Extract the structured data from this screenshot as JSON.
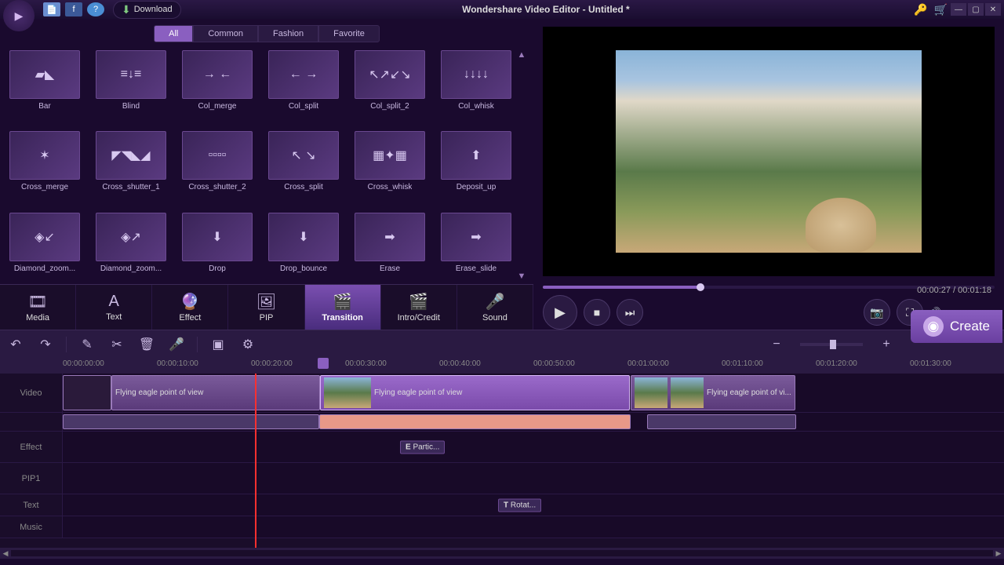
{
  "titlebar": {
    "download": "Download",
    "title": "Wondershare Video Editor - Untitled *"
  },
  "filters": [
    "All",
    "Common",
    "Fashion",
    "Favorite"
  ],
  "transitions": [
    {
      "name": "Bar",
      "glyph": "▰◣"
    },
    {
      "name": "Blind",
      "glyph": "≡↓≡"
    },
    {
      "name": "Col_merge",
      "glyph": "→ ←"
    },
    {
      "name": "Col_split",
      "glyph": "← →"
    },
    {
      "name": "Col_split_2",
      "glyph": "↖↗↙↘"
    },
    {
      "name": "Col_whisk",
      "glyph": "↓↓↓↓"
    },
    {
      "name": "Cross_merge",
      "glyph": "✶"
    },
    {
      "name": "Cross_shutter_1",
      "glyph": "◤◥◣◢"
    },
    {
      "name": "Cross_shutter_2",
      "glyph": "▫▫▫▫"
    },
    {
      "name": "Cross_split",
      "glyph": "↖ ↘"
    },
    {
      "name": "Cross_whisk",
      "glyph": "▦✦▦"
    },
    {
      "name": "Deposit_up",
      "glyph": "⬆"
    },
    {
      "name": "Diamond_zoom...",
      "glyph": "◈↙"
    },
    {
      "name": "Diamond_zoom...",
      "glyph": "◈↗"
    },
    {
      "name": "Drop",
      "glyph": "⬇"
    },
    {
      "name": "Drop_bounce",
      "glyph": "⬇"
    },
    {
      "name": "Erase",
      "glyph": "➡"
    },
    {
      "name": "Erase_slide",
      "glyph": "➡"
    }
  ],
  "categories": [
    "Media",
    "Text",
    "Effect",
    "PIP",
    "Transition",
    "Intro/Credit",
    "Sound"
  ],
  "cat_icons": [
    "🎞",
    "A",
    "🔮",
    "🖼",
    "🎬",
    "🎬",
    "🎤"
  ],
  "preview": {
    "current": "00:00:27",
    "total": "00:01:18"
  },
  "create_label": "Create",
  "time_marks": [
    "00:00:00:00",
    "00:00:10:00",
    "00:00:20:00",
    "00:00:30:00",
    "00:00:40:00",
    "00:00:50:00",
    "00:01:00:00",
    "00:01:10:00",
    "00:01:20:00",
    "00:01:30:00"
  ],
  "tracks": {
    "video": "Video",
    "effect": "Effect",
    "pip": "PIP1",
    "text": "Text",
    "music": "Music"
  },
  "clips": {
    "c1": "Flying eagle point of view",
    "c2": "Flying eagle point of view",
    "c3": "Flying eagle point of vi...",
    "effect": "Partic...",
    "text": "Rotat..."
  }
}
